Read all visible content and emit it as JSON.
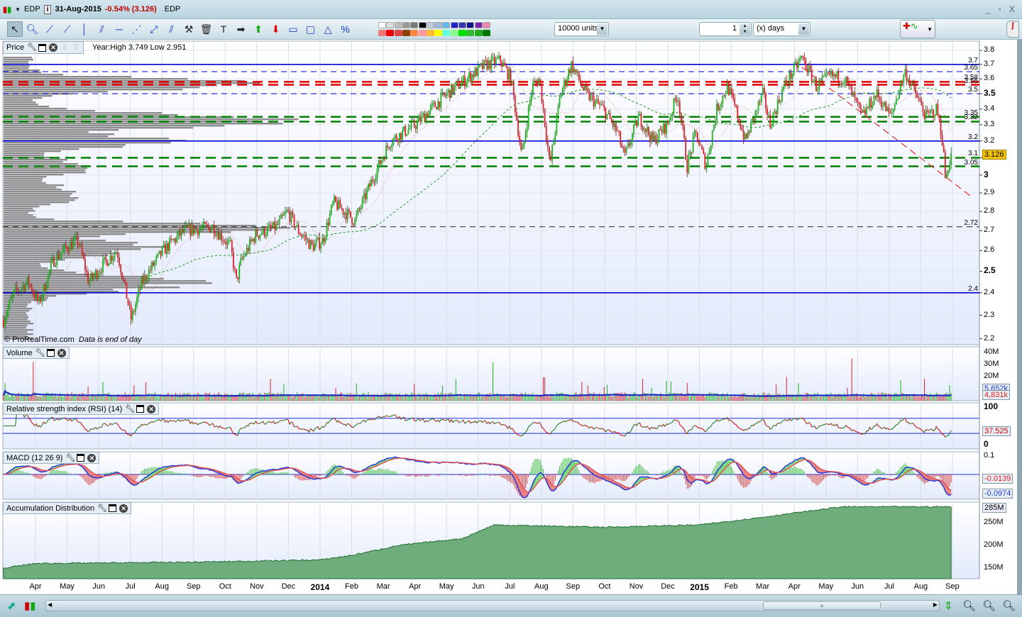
{
  "titlebar": {
    "symbol": "EDP",
    "date": "31-Aug-2015",
    "change": "-0.54% (3.126)",
    "name": "EDP",
    "window_controls": "_ ▫ X"
  },
  "toolbar": {
    "units": "10000 units",
    "period_value": "1",
    "period_unit": "(x) days",
    "tools": [
      "pointer",
      "zoom",
      "segment",
      "line",
      "vertical-line",
      "channel",
      "horizontal-line",
      "fan",
      "rectangle-points",
      "parallel",
      "properties",
      "delete",
      "text",
      "arrow-right",
      "arrow-up",
      "arrow-down",
      "rectangle",
      "ellipse",
      "triangle",
      "percent"
    ]
  },
  "colors": {
    "up": "#1db11d",
    "down": "#e0202a",
    "level_blue": "#0000e0",
    "level_red": "#e00000",
    "level_green": "#008000",
    "price_tag": "#f5c400",
    "ad_fill": "#6fae7c"
  },
  "price_panel": {
    "label": "Price",
    "info": "Year:High 3.749 Low 2.951",
    "copyright": "© ProRealTime.com",
    "note": "Data is end of day",
    "axis": [
      "3.8",
      "3.7",
      "3.6",
      "3.5",
      "3.4",
      "3.3",
      "3.2",
      "3.1",
      "3",
      "2.9",
      "2.8",
      "2.7",
      "2.6",
      "2.5",
      "2.4",
      "2.3",
      "2.2"
    ],
    "last_price": "3.126",
    "levels": [
      {
        "value": 3.7,
        "label": "3.7",
        "style": "solid",
        "color": "blue"
      },
      {
        "value": 3.65,
        "label": "3.65",
        "style": "dashed",
        "color": "blue"
      },
      {
        "value": 3.58,
        "label": "3.58",
        "style": "dashed",
        "color": "red"
      },
      {
        "value": 3.56,
        "label": "3.56",
        "style": "dashed",
        "color": "red"
      },
      {
        "value": 3.5,
        "label": "3.5",
        "style": "dashed",
        "color": "blue"
      },
      {
        "value": 3.35,
        "label": "3.35",
        "style": "dashed",
        "color": "green"
      },
      {
        "value": 3.32,
        "label": "3.32",
        "style": "dashed",
        "color": "green"
      },
      {
        "value": 3.2,
        "label": "3.2",
        "style": "solid",
        "color": "blue"
      },
      {
        "value": 3.1,
        "label": "3.1",
        "style": "dashed",
        "color": "green"
      },
      {
        "value": 3.05,
        "label": "3.05",
        "style": "dashed",
        "color": "green"
      },
      {
        "value": 2.72,
        "label": "2.72",
        "style": "dashed",
        "color": "black"
      },
      {
        "value": 2.4,
        "label": "2.4",
        "style": "solid",
        "color": "blue"
      }
    ]
  },
  "volume_panel": {
    "label": "Volume",
    "axis": [
      "40M",
      "30M",
      "20M"
    ],
    "ma_value": "5,652k",
    "last_value": "4,831k"
  },
  "rsi_panel": {
    "label": "Relative strength index (RSI) (14)",
    "axis": [
      "100",
      "0"
    ],
    "last_value": "37.525"
  },
  "macd_panel": {
    "label": "MACD (12 26 9)",
    "axis": [
      "0.1"
    ],
    "macd_value": "-0.0139",
    "signal_value": "-0.0974"
  },
  "ad_panel": {
    "label": "Accumulation Distribution",
    "axis": [
      "250M",
      "200M",
      "150M"
    ],
    "last_value": "285M"
  },
  "time_axis": [
    {
      "label": "Apr",
      "m": 0
    },
    {
      "label": "May",
      "m": 1
    },
    {
      "label": "Jun",
      "m": 2
    },
    {
      "label": "Jul",
      "m": 3
    },
    {
      "label": "Aug",
      "m": 4
    },
    {
      "label": "Sep",
      "m": 5
    },
    {
      "label": "Oct",
      "m": 6
    },
    {
      "label": "Nov",
      "m": 7
    },
    {
      "label": "Dec",
      "m": 8
    },
    {
      "label": "2014",
      "m": 9,
      "year": true
    },
    {
      "label": "Feb",
      "m": 10
    },
    {
      "label": "Mar",
      "m": 11
    },
    {
      "label": "Apr",
      "m": 12
    },
    {
      "label": "May",
      "m": 13
    },
    {
      "label": "Jun",
      "m": 14
    },
    {
      "label": "Jul",
      "m": 15
    },
    {
      "label": "Aug",
      "m": 16
    },
    {
      "label": "Sep",
      "m": 17
    },
    {
      "label": "Oct",
      "m": 18
    },
    {
      "label": "Nov",
      "m": 19
    },
    {
      "label": "Dec",
      "m": 20
    },
    {
      "label": "2015",
      "m": 21,
      "year": true
    },
    {
      "label": "Feb",
      "m": 22
    },
    {
      "label": "Mar",
      "m": 23
    },
    {
      "label": "Apr",
      "m": 24
    },
    {
      "label": "May",
      "m": 25
    },
    {
      "label": "Jun",
      "m": 26
    },
    {
      "label": "Jul",
      "m": 27
    },
    {
      "label": "Aug",
      "m": 28
    },
    {
      "label": "Sep",
      "m": 29
    }
  ],
  "chart_data": {
    "type": "candlestick",
    "x_unit": "months since Apr 2013",
    "price_scale": "log",
    "ylim": [
      2.2,
      3.8
    ],
    "price_path": [
      [
        -1.01,
        2.28
      ],
      [
        -0.67,
        2.4
      ],
      [
        -0.22,
        2.45
      ],
      [
        0.11,
        2.35
      ],
      [
        0.56,
        2.55
      ],
      [
        1.01,
        2.62
      ],
      [
        1.35,
        2.65
      ],
      [
        1.68,
        2.45
      ],
      [
        2.24,
        2.55
      ],
      [
        2.58,
        2.6
      ],
      [
        3.03,
        2.28
      ],
      [
        3.37,
        2.45
      ],
      [
        4.04,
        2.6
      ],
      [
        4.71,
        2.7
      ],
      [
        5.61,
        2.72
      ],
      [
        6.17,
        2.62
      ],
      [
        6.35,
        2.45
      ],
      [
        6.51,
        2.55
      ],
      [
        6.96,
        2.68
      ],
      [
        7.63,
        2.72
      ],
      [
        7.97,
        2.8
      ],
      [
        8.31,
        2.7
      ],
      [
        8.75,
        2.62
      ],
      [
        9.09,
        2.65
      ],
      [
        9.43,
        2.85
      ],
      [
        10.1,
        2.75
      ],
      [
        11.22,
        3.2
      ],
      [
        12.01,
        3.3
      ],
      [
        13.02,
        3.5
      ],
      [
        14.25,
        3.7
      ],
      [
        14.7,
        3.73
      ],
      [
        15.04,
        3.6
      ],
      [
        15.38,
        3.1
      ],
      [
        15.71,
        3.55
      ],
      [
        15.94,
        3.6
      ],
      [
        16.27,
        3.05
      ],
      [
        16.61,
        3.5
      ],
      [
        16.95,
        3.7
      ],
      [
        17.4,
        3.5
      ],
      [
        17.96,
        3.4
      ],
      [
        18.41,
        3.25
      ],
      [
        18.63,
        3.1
      ],
      [
        19.08,
        3.35
      ],
      [
        19.53,
        3.2
      ],
      [
        19.98,
        3.3
      ],
      [
        20.31,
        3.5
      ],
      [
        20.61,
        3.05
      ],
      [
        20.88,
        3.25
      ],
      [
        21.21,
        3.05
      ],
      [
        21.55,
        3.4
      ],
      [
        21.89,
        3.55
      ],
      [
        22.22,
        3.35
      ],
      [
        22.45,
        3.2
      ],
      [
        23.01,
        3.5
      ],
      [
        23.23,
        3.3
      ],
      [
        23.68,
        3.55
      ],
      [
        24.24,
        3.75
      ],
      [
        24.69,
        3.55
      ],
      [
        25.14,
        3.62
      ],
      [
        25.59,
        3.6
      ],
      [
        26.15,
        3.35
      ],
      [
        26.6,
        3.5
      ],
      [
        27.05,
        3.35
      ],
      [
        27.5,
        3.65
      ],
      [
        27.83,
        3.5
      ],
      [
        28.17,
        3.35
      ],
      [
        28.51,
        3.4
      ],
      [
        28.69,
        3.2
      ],
      [
        28.78,
        2.97
      ],
      [
        28.96,
        3.13
      ]
    ],
    "trendline": [
      [
        24.24,
        3.68
      ],
      [
        29.6,
        2.88
      ]
    ],
    "ad_path_millions": [
      [
        -1,
        150
      ],
      [
        0,
        160
      ],
      [
        5,
        163
      ],
      [
        9,
        168
      ],
      [
        10,
        178
      ],
      [
        11.5,
        200
      ],
      [
        13.5,
        215
      ],
      [
        14.5,
        245
      ],
      [
        18,
        240
      ],
      [
        21,
        245
      ],
      [
        23,
        262
      ],
      [
        25.5,
        285
      ],
      [
        28.96,
        285
      ]
    ]
  }
}
